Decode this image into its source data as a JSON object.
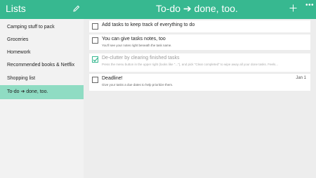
{
  "header": {
    "lists_title": "Lists",
    "page_title": "To-do ➔ done, too.",
    "edit_icon": "pencil-icon",
    "add_icon": "plus-icon",
    "more_icon": "ellipsis-icon",
    "brand_color": "#37b890"
  },
  "sidebar": {
    "items": [
      {
        "label": "Camping stuff to pack"
      },
      {
        "label": "Groceries"
      },
      {
        "label": "Homework"
      },
      {
        "label": "Recommended books & Netflix"
      },
      {
        "label": "Shopping list"
      },
      {
        "label": "To-do ➔ done, too."
      }
    ],
    "selected_index": 5,
    "selected_color": "#8fdcc3"
  },
  "tasks": [
    {
      "title": "Add tasks to keep track of everything to do",
      "note": "",
      "due": "",
      "completed": false
    },
    {
      "title": "You can give tasks notes, too",
      "note": "You'll see your notes right beneath the task name.",
      "due": "",
      "completed": false
    },
    {
      "title": "De-clutter by clearing finished tasks",
      "note": "Press the menu button in the upper right (looks like \"...\"), and pick \"Clear completed\" to wipe away all your done tasks. Feels...",
      "due": "",
      "completed": true
    },
    {
      "title": "Deadline!",
      "note": "Give your tasks a due dates to help prioritize them.",
      "due": "Jan 1",
      "completed": false
    }
  ]
}
